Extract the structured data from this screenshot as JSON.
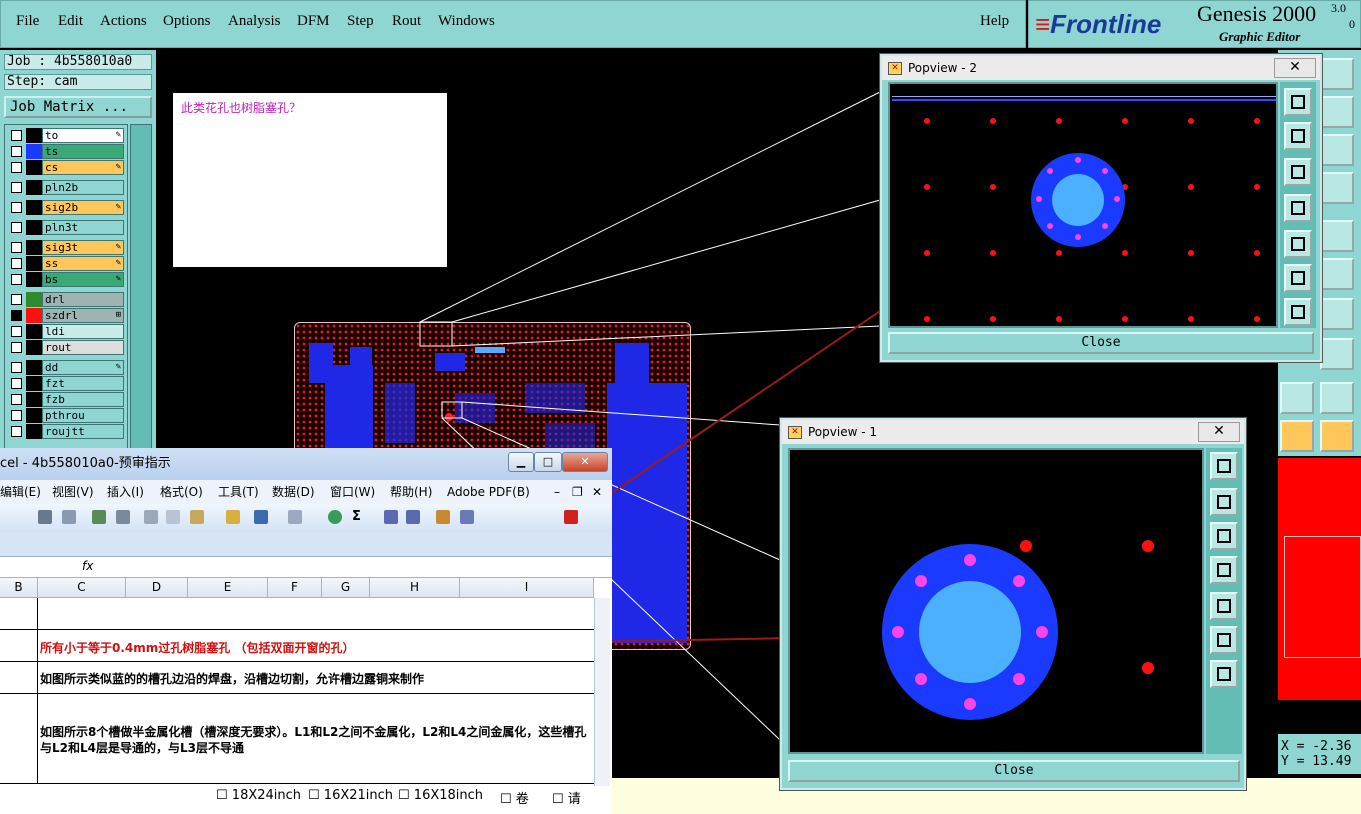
{
  "menubar": {
    "items": [
      {
        "label": "File",
        "u": "F"
      },
      {
        "label": "Edit",
        "u": "E"
      },
      {
        "label": "Actions",
        "u": "A"
      },
      {
        "label": "Options",
        "u": "O"
      },
      {
        "label": "Analysis",
        "u": "A"
      },
      {
        "label": "DFM",
        "u": "D"
      },
      {
        "label": "Step",
        "u": "S"
      },
      {
        "label": "Rout",
        "u": "R"
      },
      {
        "label": "Windows",
        "u": "W"
      }
    ],
    "help": "Help"
  },
  "logo": {
    "brand": "Frontline",
    "product": "Genesis 2000",
    "version_top": "3.0",
    "version_bottom": "0",
    "subtitle": "Graphic Editor"
  },
  "left_panel": {
    "job": "Job : 4b558010a0",
    "step": "Step: cam",
    "job_matrix": "Job Matrix ..."
  },
  "layers": [
    {
      "name": "to",
      "color": "#ffffff",
      "swatch": "#000000",
      "icon": "✎",
      "cb_dark": false
    },
    {
      "name": "ts",
      "color": "#3aa877",
      "swatch": "#1a3aff",
      "icon": "",
      "cb_dark": false
    },
    {
      "name": "cs",
      "color": "#ffc65a",
      "swatch": "#000000",
      "icon": "✎",
      "cb_dark": false
    },
    {
      "name": "pln2b",
      "color": "#8fd6d3",
      "swatch": "#000000",
      "icon": "",
      "cb_dark": false
    },
    {
      "name": "sig2b",
      "color": "#ffc65a",
      "swatch": "#000000",
      "icon": "✎",
      "cb_dark": false
    },
    {
      "name": "pln3t",
      "color": "#8fd6d3",
      "swatch": "#000000",
      "icon": "",
      "cb_dark": false
    },
    {
      "name": "sig3t",
      "color": "#ffc65a",
      "swatch": "#000000",
      "icon": "✎",
      "cb_dark": false
    },
    {
      "name": "ss",
      "color": "#ffc65a",
      "swatch": "#000000",
      "icon": "✎",
      "cb_dark": false
    },
    {
      "name": "bs",
      "color": "#3aa877",
      "swatch": "#000000",
      "icon": "✎",
      "cb_dark": false
    },
    {
      "name": "drl",
      "color": "#9fb4b2",
      "swatch": "#2e8a2e",
      "icon": "",
      "cb_dark": false
    },
    {
      "name": "szdrl",
      "color": "#9fb4b2",
      "swatch": "#ff1010",
      "icon": "⊞",
      "cb_dark": true
    },
    {
      "name": "ldi",
      "color": "#c9ecea",
      "swatch": "#000000",
      "icon": "",
      "cb_dark": false
    },
    {
      "name": "rout",
      "color": "#dddddd",
      "swatch": "#000000",
      "icon": "",
      "cb_dark": false
    },
    {
      "name": "dd",
      "color": "#8fd6d3",
      "swatch": "#000000",
      "icon": "✎",
      "cb_dark": false
    },
    {
      "name": "fzt",
      "color": "#8fd6d3",
      "swatch": "#000000",
      "icon": "",
      "cb_dark": false
    },
    {
      "name": "fzb",
      "color": "#8fd6d3",
      "swatch": "#000000",
      "icon": "",
      "cb_dark": false
    },
    {
      "name": "pthrou",
      "color": "#8fd6d3",
      "swatch": "#000000",
      "icon": "",
      "cb_dark": false
    },
    {
      "name": "roujtt",
      "color": "#8fd6d3",
      "swatch": "#000000",
      "icon": "",
      "cb_dark": false
    }
  ],
  "canvas": {
    "note_text": "此类花孔也树脂塞孔？"
  },
  "popview2": {
    "title": "Popview - 2",
    "close": "Close",
    "x": "✕"
  },
  "popview1": {
    "title": "Popview - 1",
    "close": "Close",
    "x": "✕"
  },
  "coords": {
    "x": "X = -2.36",
    "y": "Y = 13.49"
  },
  "excel": {
    "title": "cel - 4b558010a0-预审指示",
    "menu": [
      "编辑(E)",
      "视图(V)",
      "插入(I)",
      "格式(O)",
      "工具(T)",
      "数据(D)",
      "窗口(W)",
      "帮助(H)",
      "Adobe PDF(B)"
    ],
    "fx": "fx",
    "columns": [
      "B",
      "C",
      "D",
      "E",
      "F",
      "G",
      "H",
      "I"
    ],
    "rows": [
      {
        "text": "",
        "color": "#000000"
      },
      {
        "text": "所有小于等于0.4mm过孔树脂塞孔 （包括双面开窗的孔）",
        "color": "#d01010"
      },
      {
        "text": "如图所示类似蓝的的槽孔边沿的焊盘，沿槽边切割，允许槽边露铜来制作",
        "color": "#000000"
      },
      {
        "text": "如图所示8个槽做半金属化槽（槽深度无要求）。L1和L2之间不金属化，L2和L4之间金属化，这些槽孔与L2和L4层是导通的，与L3层不导通",
        "color": "#000000"
      }
    ],
    "panel_sizes": [
      "18X24inch",
      "16X21inch",
      "16X18inch",
      "卷",
      "请"
    ]
  }
}
